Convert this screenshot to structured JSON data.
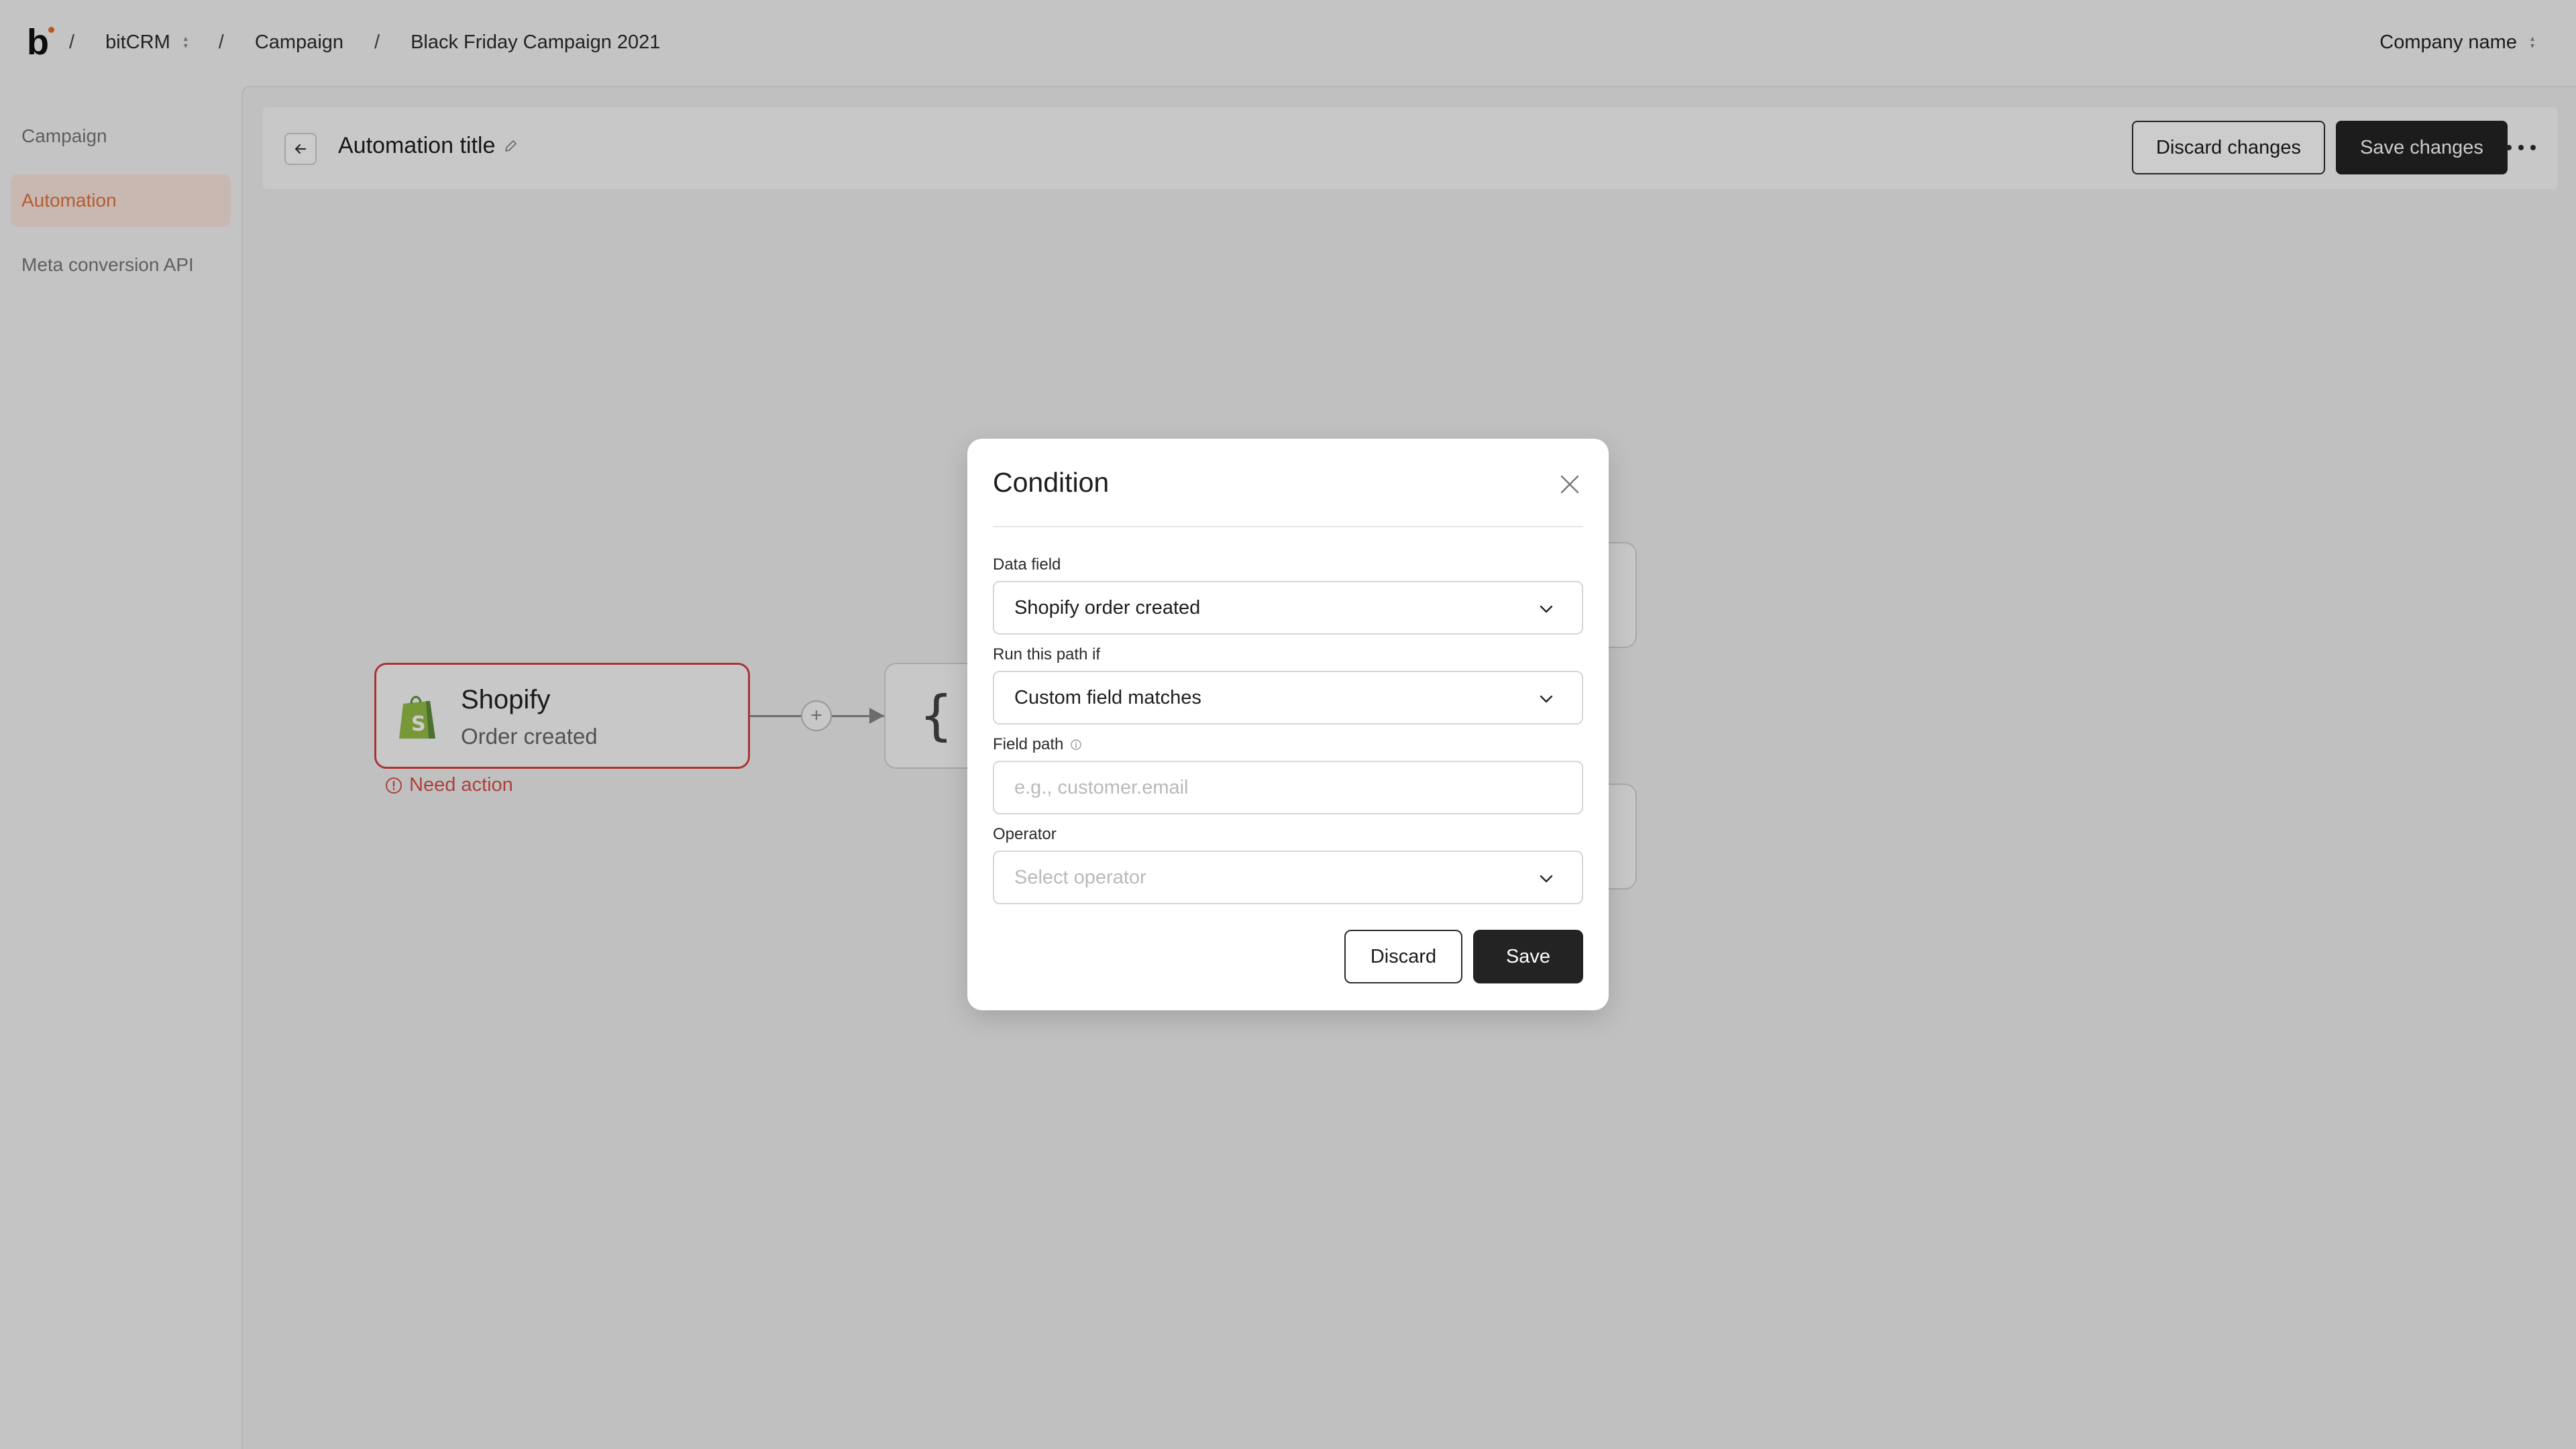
{
  "topbar": {
    "logo": "b",
    "breadcrumb": [
      "bitCRM",
      "Campaign",
      "Black Friday Campaign 2021"
    ],
    "separator": "/",
    "company": "Company name"
  },
  "sidebar": {
    "items": [
      {
        "label": "Campaign",
        "active": false
      },
      {
        "label": "Automation",
        "active": true
      },
      {
        "label": "Meta conversion API",
        "active": false
      }
    ]
  },
  "header": {
    "title": "Automation title",
    "discard_label": "Discard changes",
    "save_label": "Save changes"
  },
  "canvas": {
    "trigger": {
      "name": "Shopify",
      "event": "Order created",
      "warning": "Need action"
    },
    "branch_glyph": "{",
    "plus": "+"
  },
  "modal": {
    "title": "Condition",
    "data_field": {
      "label": "Data field",
      "value": "Shopify order created"
    },
    "run_if": {
      "label": "Run this path if",
      "value": "Custom field matches"
    },
    "field_path": {
      "label": "Field path",
      "placeholder": "e.g., customer.email"
    },
    "operator": {
      "label": "Operator",
      "placeholder": "Select operator"
    },
    "discard_label": "Discard",
    "save_label": "Save"
  },
  "colors": {
    "accent": "#e2743f",
    "error": "#d64040",
    "dark_button": "#232323",
    "shopify_green": "#95bf47"
  }
}
